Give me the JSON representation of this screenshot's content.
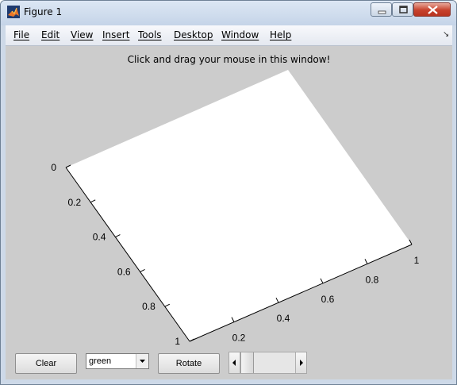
{
  "window": {
    "title": "Figure 1",
    "controls": {
      "minimize": "minimize-icon",
      "maximize": "maximize-icon",
      "close": "close-icon"
    }
  },
  "menubar": {
    "items": [
      "File",
      "Edit",
      "View",
      "Insert",
      "Tools",
      "Desktop",
      "Window",
      "Help"
    ]
  },
  "figure": {
    "title": "Click and drag your mouse in this window!",
    "background": "#cccccc",
    "axes_face": "#ffffff"
  },
  "axes": {
    "left_ticks": [
      "0",
      "0.2",
      "0.4",
      "0.6",
      "0.8",
      "1"
    ],
    "bottom_ticks": [
      "0.2",
      "0.4",
      "0.6",
      "0.8",
      "1"
    ]
  },
  "controls": {
    "clear_label": "Clear",
    "color_value": "green",
    "rotate_label": "Rotate",
    "slider_value_fraction": 0.15
  }
}
